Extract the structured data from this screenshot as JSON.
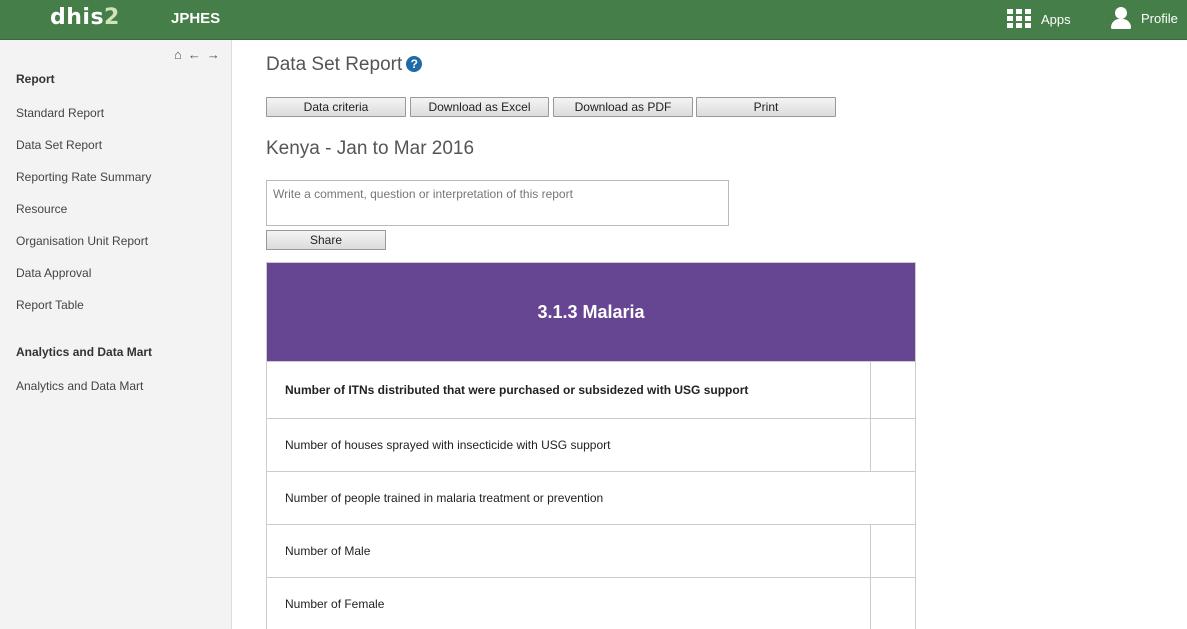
{
  "header": {
    "logo_main": "dhis",
    "logo_num": "2",
    "title": "JPHES",
    "apps_label": "Apps",
    "profile_label": "Profile"
  },
  "sidebar": {
    "nav_icons": [
      "home-icon",
      "arrow-left-icon",
      "arrow-right-icon"
    ],
    "sections": [
      {
        "heading": "Report",
        "items": [
          "Standard Report",
          "Data Set Report",
          "Reporting Rate Summary",
          "Resource",
          "Organisation Unit Report",
          "Data Approval",
          "Report Table"
        ]
      },
      {
        "heading": "Analytics and Data Mart",
        "items": [
          "Analytics and Data Mart"
        ]
      }
    ]
  },
  "main": {
    "page_title": "Data Set Report",
    "help_glyph": "?",
    "buttons": {
      "data_criteria": "Data criteria",
      "download_excel": "Download as Excel",
      "download_pdf": "Download as PDF",
      "print": "Print"
    },
    "report_title": "Kenya - Jan to Mar 2016",
    "comment_placeholder": "Write a comment, question or interpretation of this report",
    "share_label": "Share",
    "section": {
      "title": "3.1.3 Malaria",
      "color": "#664592",
      "rows": [
        {
          "label": "Number of ITNs distributed that were purchased or subsidezed with USG support",
          "value": ""
        },
        {
          "label": "Number of houses sprayed with insecticide with USG support",
          "value": ""
        },
        {
          "label": "Number of people trained in malaria treatment or prevention"
        },
        {
          "label": "Number of Male",
          "value": ""
        },
        {
          "label": "Number of Female",
          "value": ""
        }
      ]
    }
  },
  "colors": {
    "header_bg": "#467e4a",
    "sidebar_bg": "#f3f3f3",
    "accent": "#1e6ba8"
  }
}
